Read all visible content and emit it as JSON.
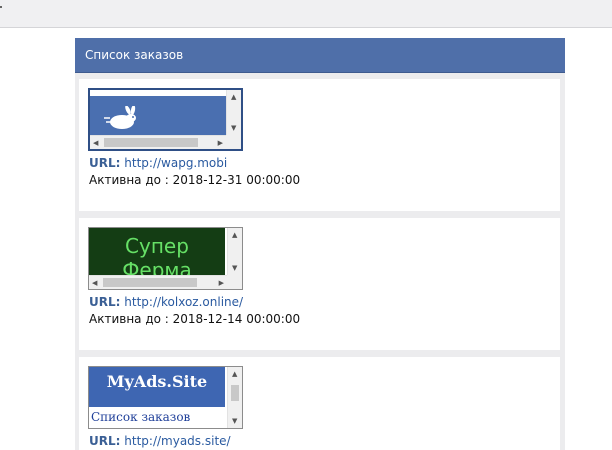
{
  "panel": {
    "title": "Список заказов"
  },
  "orders": [
    {
      "url_label": "URL:",
      "url": "http://wapg.mobi",
      "active_label": "Активна до :",
      "active_until": "2018-12-31 00:00:00"
    },
    {
      "url_label": "URL:",
      "url": "http://kolxoz.online/",
      "active_label": "Активна до :",
      "active_until": "2018-12-14 00:00:00",
      "banner_text_1": "Супер",
      "banner_text_2": "Ферма"
    },
    {
      "url_label": "URL:",
      "url": "http://myads.site/",
      "banner_title": "MyAds.Site",
      "banner_sub": "Список заказов"
    }
  ],
  "colors": {
    "header": "#4f6fa9",
    "link": "#2a5aa0",
    "label": "#3a5f95"
  },
  "icons": [
    "rabbit-logo-icon",
    "scroll-up-arrow-icon",
    "scroll-down-arrow-icon",
    "scroll-left-arrow-icon",
    "scroll-right-arrow-icon"
  ]
}
